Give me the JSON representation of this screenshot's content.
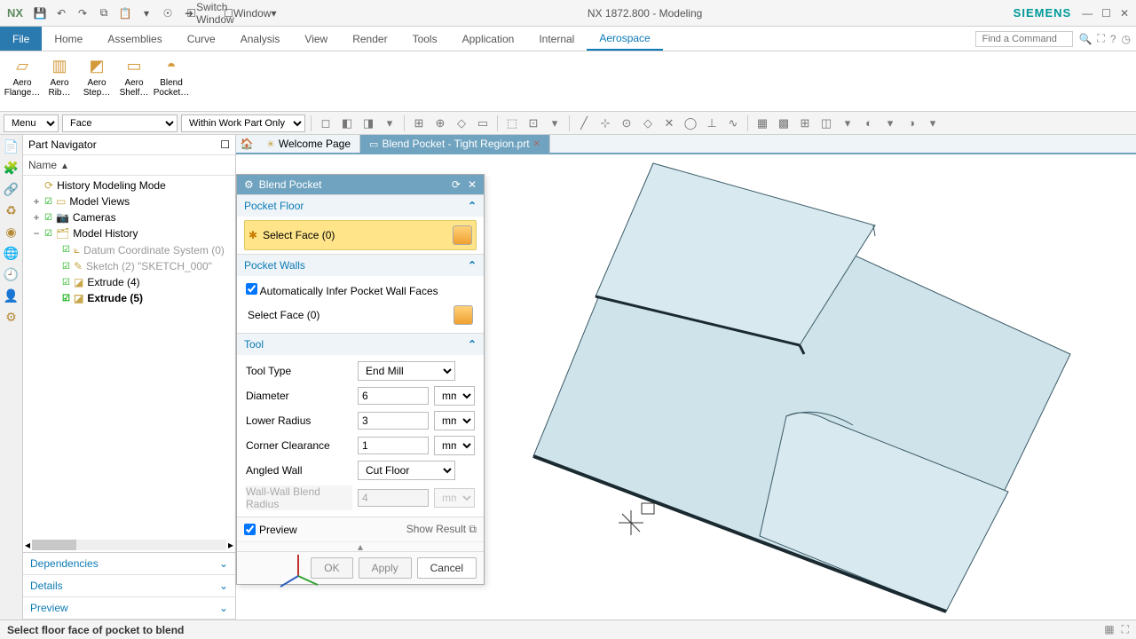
{
  "app": {
    "logo": "NX",
    "title": "NX 1872.800 - Modeling",
    "brand": "SIEMENS"
  },
  "qat": {
    "items": [
      "save",
      "undo",
      "redo",
      "copy",
      "paste",
      "cut",
      "touch",
      "win"
    ],
    "switch_window": "Switch Window",
    "window": "Window"
  },
  "menu_tabs": {
    "file": "File",
    "items": [
      "Home",
      "Assemblies",
      "Curve",
      "Analysis",
      "View",
      "Render",
      "Tools",
      "Application",
      "Internal",
      "Aerospace"
    ],
    "active": "Aerospace"
  },
  "command_search": {
    "placeholder": "Find a Command"
  },
  "ribbon": [
    {
      "label": "Aero Flange…"
    },
    {
      "label": "Aero Rib…"
    },
    {
      "label": "Aero Step…"
    },
    {
      "label": "Aero Shelf…"
    },
    {
      "label": "Blend Pocket…"
    }
  ],
  "seltool": {
    "menu": "Menu",
    "filter": "Face",
    "scope": "Within Work Part Only"
  },
  "navigator": {
    "title": "Part Navigator",
    "header": "Name",
    "tree": {
      "history_mode": "History Modeling Mode",
      "model_views": "Model Views",
      "cameras": "Cameras",
      "model_history": "Model History",
      "children": [
        {
          "label": "Datum Coordinate System (0)",
          "dim": true
        },
        {
          "label": "Sketch (2) \"SKETCH_000\"",
          "dim": true
        },
        {
          "label": "Extrude (4)",
          "dim": false
        },
        {
          "label": "Extrude (5)",
          "dim": false,
          "bold": true
        }
      ]
    },
    "panels": [
      "Dependencies",
      "Details",
      "Preview"
    ]
  },
  "doc_tabs": {
    "welcome": "Welcome Page",
    "active": "Blend Pocket - Tight Region.prt"
  },
  "dialog": {
    "title": "Blend Pocket",
    "sections": {
      "pocket_floor": {
        "title": "Pocket Floor",
        "select_face": "Select Face (0)"
      },
      "pocket_walls": {
        "title": "Pocket Walls",
        "auto_infer": "Automatically Infer Pocket Wall Faces",
        "auto_checked": true,
        "select_face": "Select Face (0)"
      },
      "tool": {
        "title": "Tool",
        "tool_type_label": "Tool Type",
        "tool_type_value": "End Mill",
        "diameter_label": "Diameter",
        "diameter_value": "6",
        "diameter_unit": "mm",
        "lower_radius_label": "Lower Radius",
        "lower_radius_value": "3",
        "lower_radius_unit": "mm",
        "corner_clear_label": "Corner Clearance",
        "corner_clear_value": "1",
        "corner_clear_unit": "mm",
        "angled_wall_label": "Angled Wall",
        "angled_wall_value": "Cut Floor",
        "wwblend_label": "Wall-Wall Blend Radius",
        "wwblend_value": "4",
        "wwblend_unit": "mm"
      }
    },
    "preview_label": "Preview",
    "preview_checked": true,
    "show_result": "Show Result",
    "ok": "OK",
    "apply": "Apply",
    "cancel": "Cancel"
  },
  "status": {
    "message": "Select floor face of pocket to blend"
  }
}
